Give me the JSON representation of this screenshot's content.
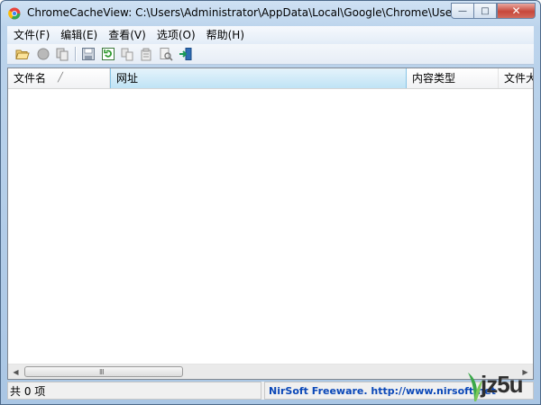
{
  "window": {
    "title": "ChromeCacheView:  C:\\Users\\Administrator\\AppData\\Local\\Google\\Chrome\\User D...",
    "controls": {
      "minimize": "—",
      "maximize": "□",
      "close": "✕"
    }
  },
  "menu": {
    "items": [
      "文件(F)",
      "编辑(E)",
      "查看(V)",
      "选项(O)",
      "帮助(H)"
    ]
  },
  "toolbar": {
    "icons": [
      "open-folder-icon",
      "stop-icon",
      "copy-files-icon",
      "save-icon",
      "refresh-icon",
      "copy-icon",
      "properties-icon",
      "find-icon",
      "exit-icon"
    ]
  },
  "list": {
    "columns": [
      "文件名",
      "网址",
      "内容类型",
      "文件大"
    ],
    "sorted_column": "文件名",
    "rows": []
  },
  "scrollbar": {
    "grip": "Ⅲ"
  },
  "status": {
    "count": "共 0 项",
    "credit": "NirSoft Freeware.  http://www.nirsoft.net"
  },
  "watermark": {
    "text": "jz5u"
  },
  "colors": {
    "title_gradient": "#bcd4ec",
    "header_selected": "#bfe3f5",
    "link": "#0a47b8",
    "close_button": "#c7473a"
  }
}
